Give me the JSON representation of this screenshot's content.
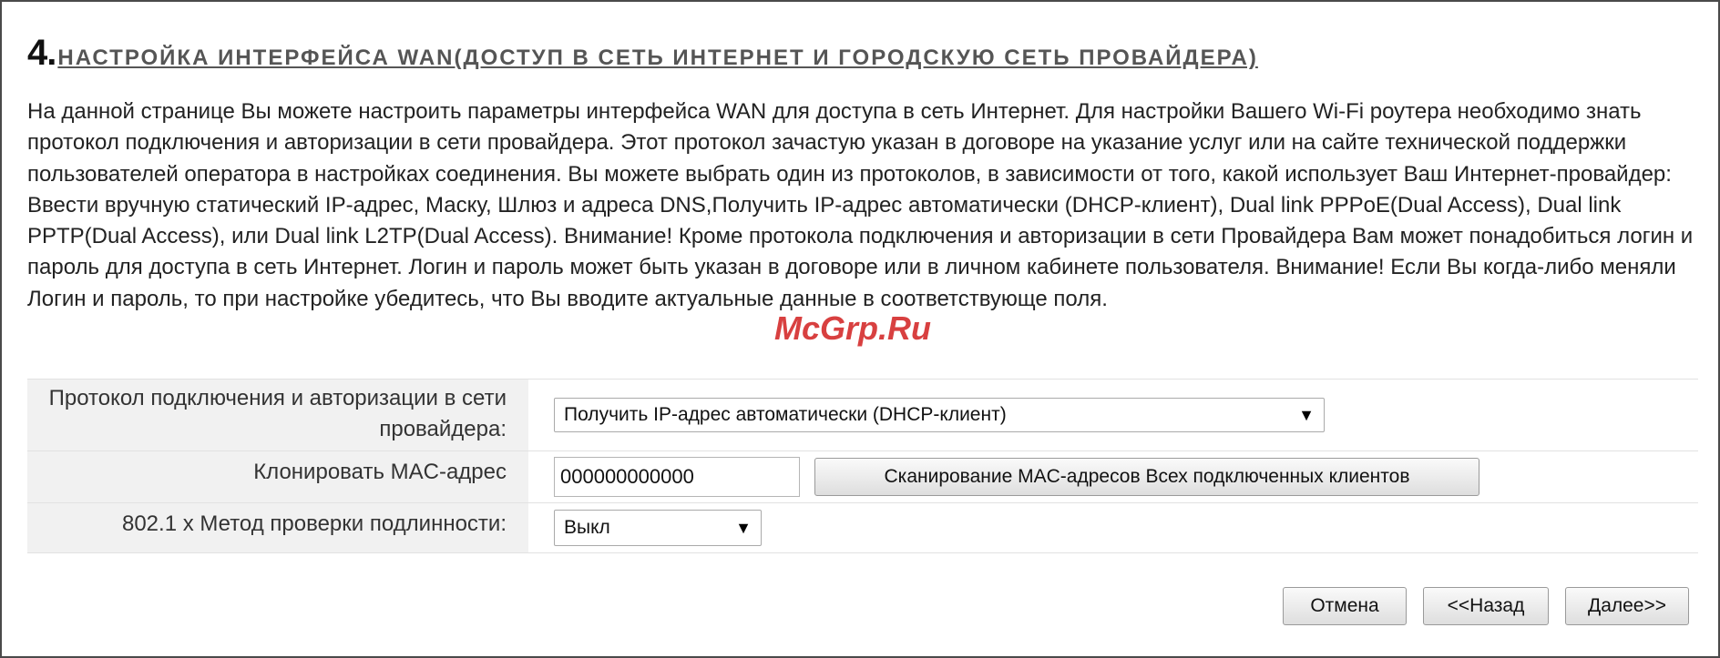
{
  "header": {
    "number": "4.",
    "title": "НАСТРОЙКА ИНТЕРФЕЙСА WAN(ДОСТУП В СЕТЬ ИНТЕРНЕТ И ГОРОДСКУЮ СЕТЬ ПРОВАЙДЕРА)"
  },
  "intro": "На данной странице Вы можете настроить параметры интерфейса WAN для доступа в сеть Интернет. Для настройки Вашего Wi-Fi роутера необходимо знать протокол подключения и авторизации в сети провайдера. Этот протокол зачастую указан в договоре на указание услуг или на сайте технической поддержки пользователей оператора в настройках соединения. Вы можете выбрать один из протоколов, в зависимости от того, какой использует Ваш Интернет-провайдер: Ввести вручную статический IP-адрес, Маску, Шлюз и адреса DNS,Получить IP-адрес автоматически (DHCP-клиент), Dual link PPPoE(Dual Access), Dual link PPTP(Dual Access), или Dual link L2TP(Dual Access). Внимание! Кроме протокола подключения и авторизации в сети Провайдера Вам может понадобиться логин и пароль для доступа в сеть Интернет. Логин и пароль может быть указан в договоре или в личном кабинете пользователя. Внимание! Если Вы когда-либо меняли Логин и пароль, то при настройке убедитесь, что Вы вводите актуальные данные в соответствующе поля.",
  "watermark": "McGrp.Ru",
  "form": {
    "protocol": {
      "label": "Протокол подключения и авторизации в сети провайдера:",
      "selected": "Получить IP-адрес автоматически (DHCP-клиент)",
      "arrow": "▼"
    },
    "mac": {
      "label": "Клонировать MAC-адрес",
      "value": "000000000000",
      "scan_button": "Сканирование MAC-адресов Всех подключенных клиентов"
    },
    "auth": {
      "label": "802.1 x Метод проверки подлинности:",
      "selected": "Выкл",
      "arrow": "▼"
    }
  },
  "actions": {
    "cancel": "Отмена",
    "back": "<<Назад",
    "next": "Далее>>"
  }
}
